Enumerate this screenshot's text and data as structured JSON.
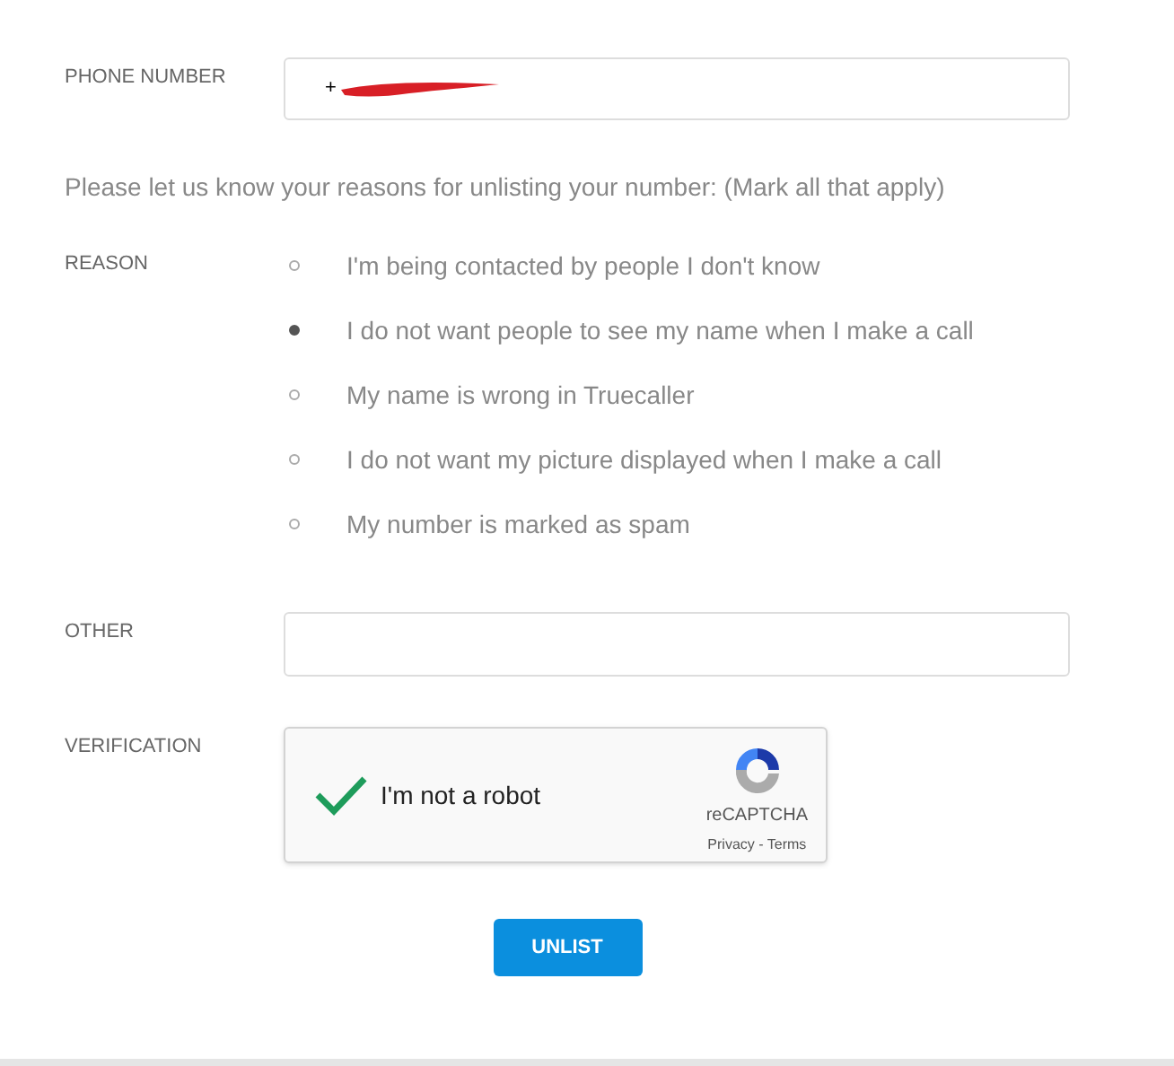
{
  "phone_number": {
    "label": "PHONE NUMBER",
    "value": "+",
    "redacted": true
  },
  "prompt": "Please let us know your reasons for unlisting your number: (Mark all that apply)",
  "reason": {
    "label": "REASON",
    "options": [
      {
        "label": "I'm being contacted by people I don't know",
        "checked": false
      },
      {
        "label": "I do not want people to see my name when I make a call",
        "checked": true
      },
      {
        "label": "My name is wrong in Truecaller",
        "checked": false
      },
      {
        "label": "I do not want my picture displayed when I make a call",
        "checked": false
      },
      {
        "label": "My number is marked as spam",
        "checked": false
      }
    ]
  },
  "other": {
    "label": "OTHER"
  },
  "verification": {
    "label": "VERIFICATION",
    "checked": true,
    "text": "I'm not a robot",
    "brand": "reCAPTCHA",
    "links": "Privacy - Terms"
  },
  "submit": "UNLIST"
}
